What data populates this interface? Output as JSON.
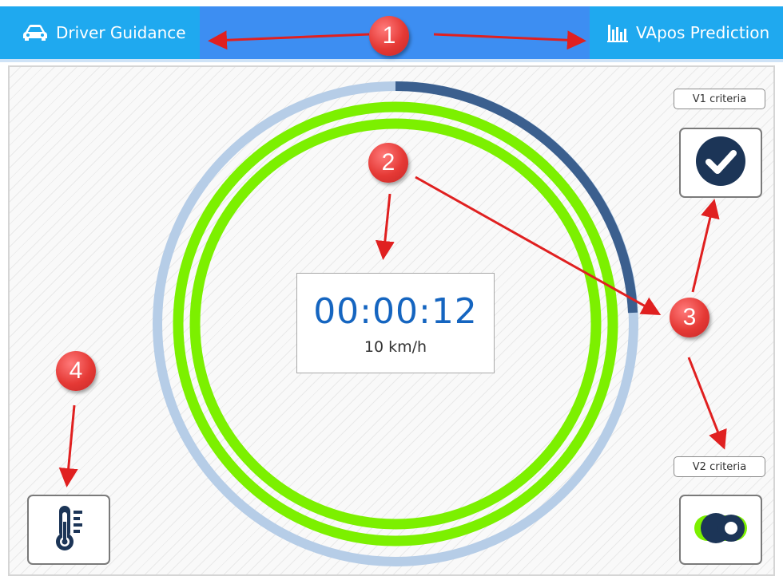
{
  "tabs": {
    "driver_guidance": {
      "label": "Driver Guidance",
      "icon": "car-icon"
    },
    "vapos_prediction": {
      "label": "VApos Prediction",
      "icon": "bar-chart-icon"
    }
  },
  "timer": {
    "elapsed": "00:00:12",
    "speed": "10 km/h"
  },
  "criteria": {
    "v1": {
      "label": "V1 criteria",
      "status_icon": "check-circle-icon"
    },
    "v2": {
      "label": "V2 criteria",
      "status_icon": "toggle-icon"
    }
  },
  "temperature_button": {
    "icon": "thermometer-icon"
  },
  "annotations": [
    "1",
    "2",
    "3",
    "4"
  ],
  "colors": {
    "header": "#1fa9ef",
    "header_active": "#3d8ef2",
    "ring_green": "#7cf000",
    "ring_light": "#b6cde7",
    "ring_progress": "#3b5f8e",
    "timer_text": "#1565c0",
    "badge": "#e53935",
    "arrow": "#e02020"
  }
}
